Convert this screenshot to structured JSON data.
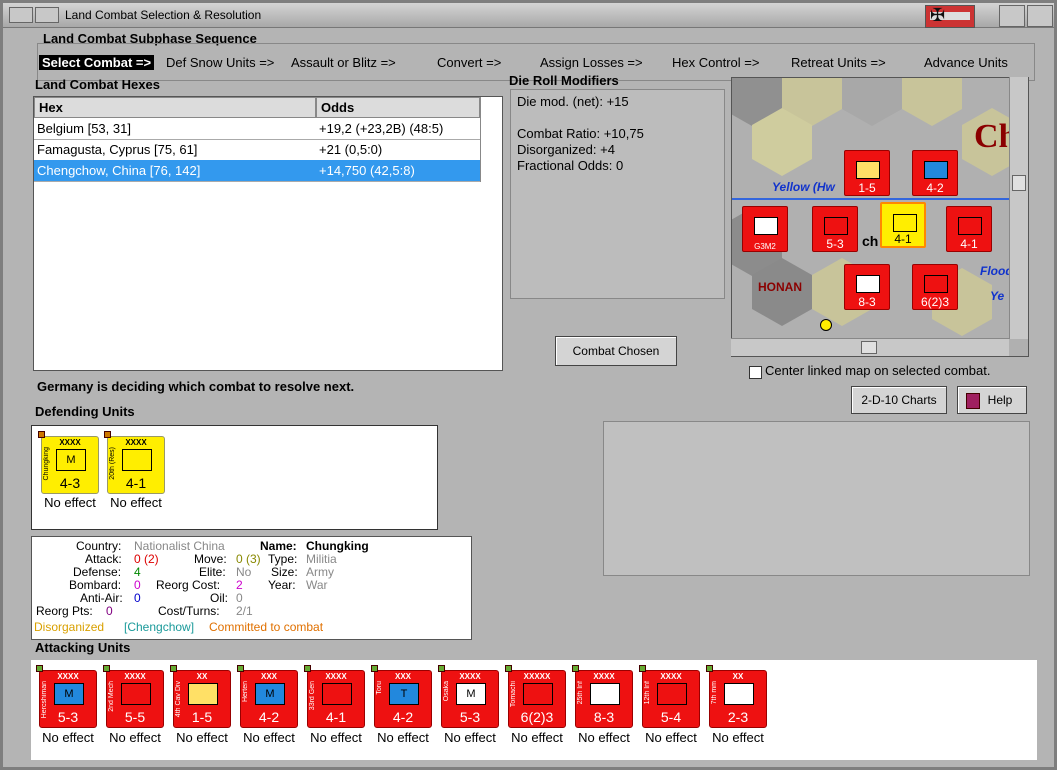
{
  "window": {
    "title": "Land Combat Selection & Resolution"
  },
  "subphase": {
    "heading": "Land Combat Subphase Sequence",
    "steps": [
      "Select Combat =>",
      "Def Snow Units =>",
      "Assault or Blitz =>",
      "Convert =>",
      "Assign Losses =>",
      "Hex Control =>",
      "Retreat Units =>",
      "Advance Units"
    ]
  },
  "hexes": {
    "heading": "Land Combat Hexes",
    "columns": [
      "Hex",
      "Odds"
    ],
    "rows": [
      {
        "hex": "Belgium [53, 31]",
        "odds": "+19,2 (+23,2B) (48:5)"
      },
      {
        "hex": "Famagusta, Cyprus [75, 61]",
        "odds": "+21 (0,5:0)"
      },
      {
        "hex": "Chengchow, China [76, 142]",
        "odds": "+14,750 (42,5:8)"
      }
    ]
  },
  "modifiers": {
    "heading": "Die Roll Modifiers",
    "lines": [
      "Die mod. (net): +15",
      "",
      "Combat Ratio: +10,75",
      "Disorganized: +4",
      "Fractional Odds: 0"
    ]
  },
  "buttons": {
    "combat_chosen": "Combat Chosen",
    "charts": "2-D-10 Charts",
    "help": "Help"
  },
  "map": {
    "labels": [
      "Yellow (Hw",
      "HONAN",
      "Flood",
      "Ye",
      "Ch",
      "ch"
    ],
    "center_label": "Center linked map on selected combat."
  },
  "status_text": "Germany is deciding which combat to resolve next.",
  "defending": {
    "heading": "Defending Units",
    "units": [
      {
        "name": "Chungking",
        "size": "XXXX",
        "strength": "4-3",
        "type": "M",
        "effect": "No effect"
      },
      {
        "name": "20th (Res)",
        "size": "XXXX",
        "strength": "4-1",
        "type": "",
        "effect": "No effect"
      }
    ]
  },
  "info": {
    "country_label": "Country:",
    "country": "Nationalist China",
    "name_label": "Name:",
    "name": "Chungking",
    "attack_label": "Attack:",
    "attack": "0 (2)",
    "move_label": "Move:",
    "move": "0 (3)",
    "type_label": "Type:",
    "type": "Militia",
    "defense_label": "Defense:",
    "defense": "4",
    "elite_label": "Elite:",
    "elite": "No",
    "size_label": "Size:",
    "size": "Army",
    "bombard_label": "Bombard:",
    "bombard": "0",
    "reorg_cost_label": "Reorg Cost:",
    "reorg_cost": "2",
    "year_label": "Year:",
    "year": "War",
    "antiair_label": "Anti-Air:",
    "antiair": "0",
    "oil_label": "Oil:",
    "oil": "0",
    "reorg_pts_label": "Reorg Pts:",
    "reorg_pts": "0",
    "cost_label": "Cost/Turns:",
    "cost": "2/1",
    "flag1": "Disorganized",
    "flag2": "[Chengchow]",
    "flag3": "Committed to combat"
  },
  "attacking": {
    "heading": "Attacking Units",
    "units": [
      {
        "name": "Hercshiman",
        "size": "XXXX",
        "strength": "5-3",
        "type": "M",
        "effect": "No effect"
      },
      {
        "name": "2nd Mech",
        "size": "XXXX",
        "strength": "5-5",
        "type": "",
        "effect": "No effect"
      },
      {
        "name": "4th Cav Div",
        "size": "XX",
        "strength": "1-5",
        "type": "",
        "effect": "No effect"
      },
      {
        "name": "Herten",
        "size": "XXX",
        "strength": "4-2",
        "type": "M",
        "effect": "No effect"
      },
      {
        "name": "33rd Gen",
        "size": "XXXX",
        "strength": "4-1",
        "type": "",
        "effect": "No effect"
      },
      {
        "name": "Toru",
        "size": "XXX",
        "strength": "4-2",
        "type": "T",
        "effect": "No effect"
      },
      {
        "name": "Osaka",
        "size": "XXXX",
        "strength": "5-3",
        "type": "M",
        "effect": "No effect"
      },
      {
        "name": "Tomachi",
        "size": "XXXXX",
        "strength": "6(2)3",
        "type": "",
        "effect": "No effect"
      },
      {
        "name": "25th Inf",
        "size": "XXXX",
        "strength": "8-3",
        "type": "",
        "effect": "No effect"
      },
      {
        "name": "12th Inf",
        "size": "XXXX",
        "strength": "5-4",
        "type": "",
        "effect": "No effect"
      },
      {
        "name": "7th mm",
        "size": "XX",
        "strength": "2-3",
        "type": "",
        "effect": "No effect"
      }
    ]
  },
  "map_units": [
    {
      "strength": "1-5"
    },
    {
      "strength": "4-2"
    },
    {
      "strength": "5-3"
    },
    {
      "strength": "4-1"
    },
    {
      "strength": "4-1"
    },
    {
      "strength": "8-3"
    },
    {
      "strength": "6(2)3"
    },
    {
      "strength": "G3M2"
    }
  ],
  "colors": {
    "axis_red": "#ee1111",
    "china_yellow": "#ffee00",
    "selection": "#3399ee"
  }
}
